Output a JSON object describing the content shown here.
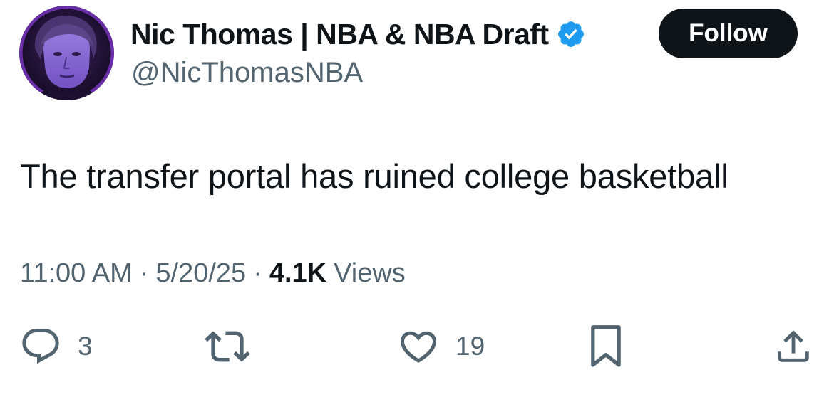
{
  "author": {
    "display_name": "Nic Thomas | NBA & NBA Draft",
    "handle": "@NicThomasNBA",
    "verified": true,
    "avatar_icon": "profile-avatar"
  },
  "follow_button": {
    "label": "Follow"
  },
  "tweet": {
    "text": "The transfer portal has ruined college basketball",
    "time": "11:00 AM",
    "date": "5/20/25",
    "separator": "·",
    "views_count": "4.1K",
    "views_label": "Views"
  },
  "actions": {
    "reply": {
      "icon": "reply-icon",
      "count": "3"
    },
    "retweet": {
      "icon": "retweet-icon",
      "count": ""
    },
    "like": {
      "icon": "heart-icon",
      "count": "19"
    },
    "bookmark": {
      "icon": "bookmark-icon"
    },
    "share": {
      "icon": "share-icon"
    }
  },
  "colors": {
    "text_primary": "#0f1419",
    "text_secondary": "#536471",
    "verified_blue": "#1d9bf0",
    "follow_bg": "#0f1419",
    "avatar_accent": "#7b3fc4"
  }
}
